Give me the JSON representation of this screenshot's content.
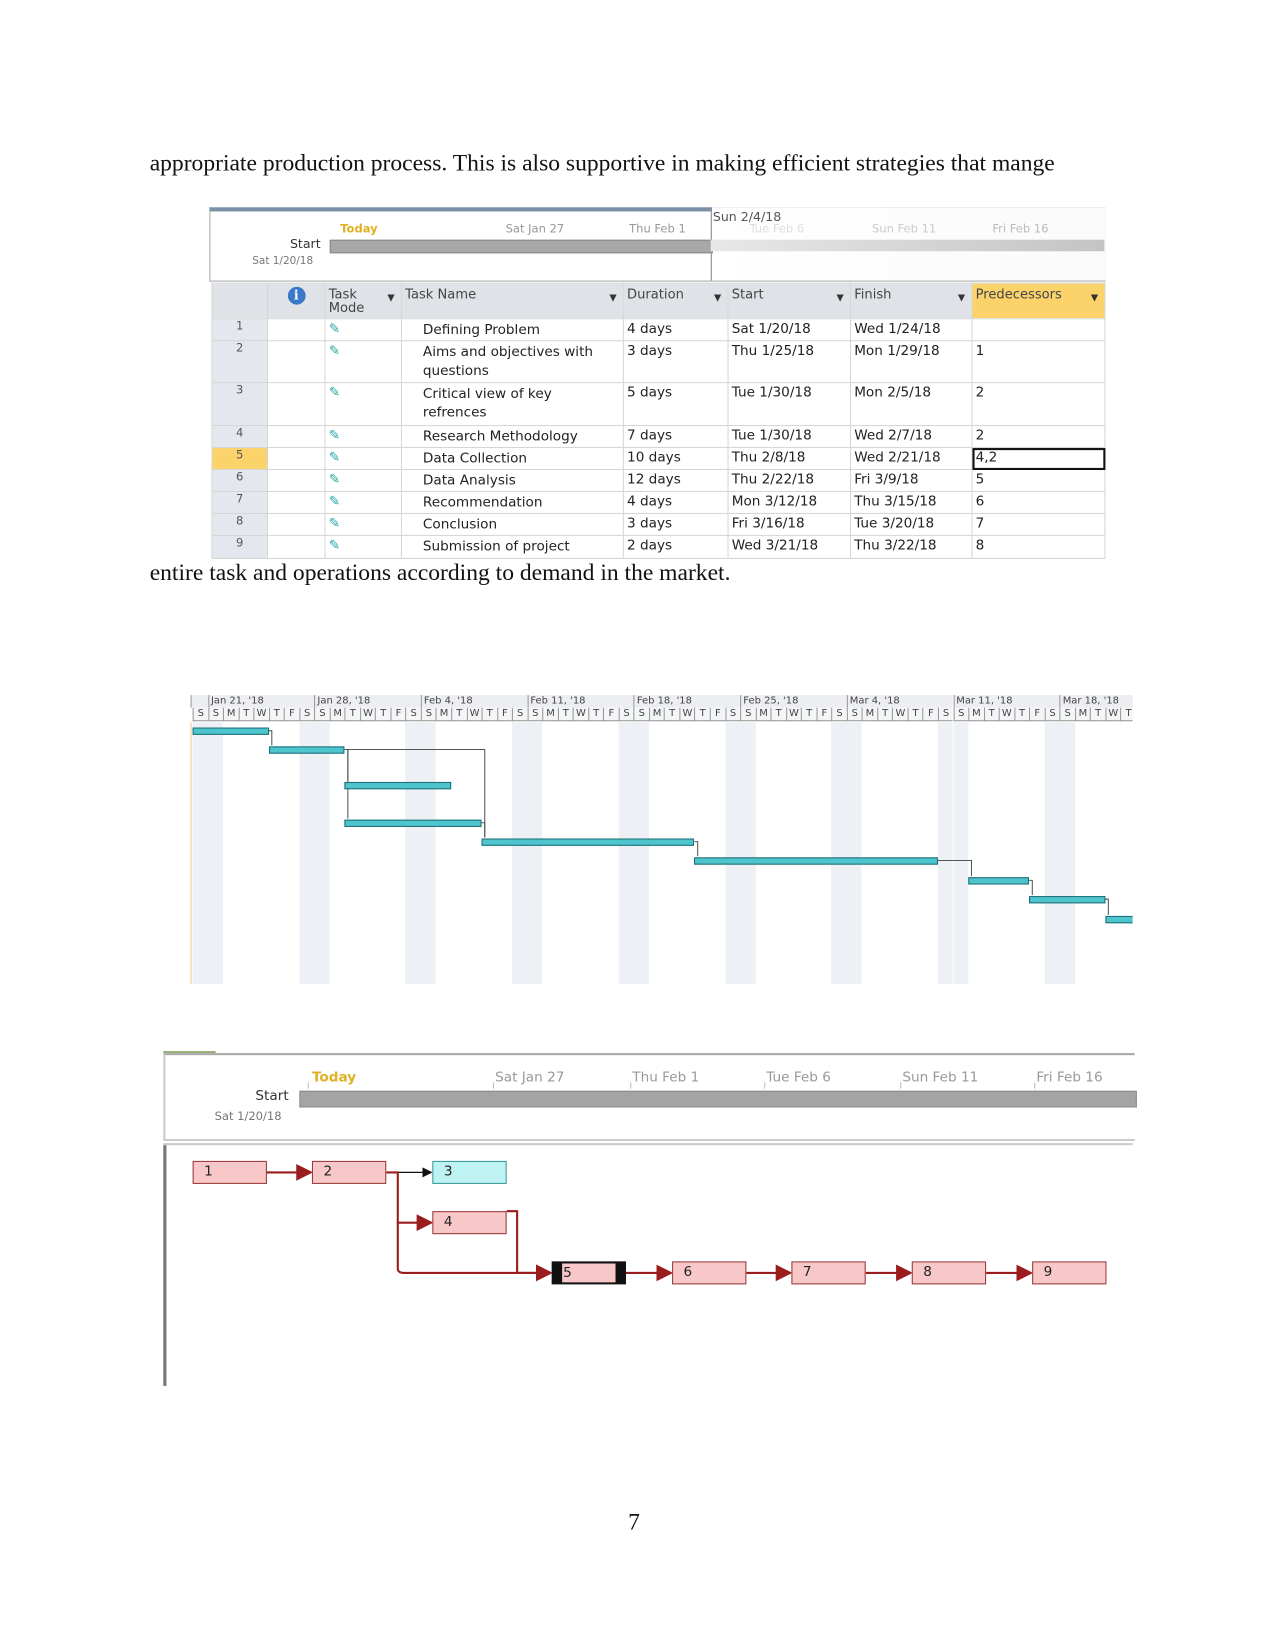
{
  "document": {
    "text_before": "appropriate production process. This is also supportive in making efficient strategies that mange",
    "text_after": "entire task and operations according to demand in the market.",
    "page_number": "7"
  },
  "timeline": {
    "today": "Today",
    "start_label": "Start",
    "start_date": "Sat 1/20/18",
    "current_marker": "Sun 2/4/18",
    "ticks": [
      "Sat Jan 27",
      "Thu Feb 1",
      "Tue Feb 6",
      "Sun Feb 11",
      "Fri Feb 16"
    ]
  },
  "table": {
    "headers": {
      "info": "i",
      "task_mode": "Task Mode",
      "task_name": "Task Name",
      "duration": "Duration",
      "start": "Start",
      "finish": "Finish",
      "predecessors": "Predecessors"
    },
    "rows": [
      {
        "id": "1",
        "name": "Defining Problem",
        "duration": "4 days",
        "start": "Sat 1/20/18",
        "finish": "Wed 1/24/18",
        "pred": ""
      },
      {
        "id": "2",
        "name": "Aims and objectives with questions",
        "duration": "3 days",
        "start": "Thu 1/25/18",
        "finish": "Mon 1/29/18",
        "pred": "1"
      },
      {
        "id": "3",
        "name": "Critical view of key refrences",
        "duration": "5 days",
        "start": "Tue 1/30/18",
        "finish": "Mon 2/5/18",
        "pred": "2"
      },
      {
        "id": "4",
        "name": "Research Methodology",
        "duration": "7 days",
        "start": "Tue 1/30/18",
        "finish": "Wed 2/7/18",
        "pred": "2"
      },
      {
        "id": "5",
        "name": "Data Collection",
        "duration": "10 days",
        "start": "Thu 2/8/18",
        "finish": "Wed 2/21/18",
        "pred": "4,2"
      },
      {
        "id": "6",
        "name": "Data Analysis",
        "duration": "12 days",
        "start": "Thu 2/22/18",
        "finish": "Fri 3/9/18",
        "pred": "5"
      },
      {
        "id": "7",
        "name": "Recommendation",
        "duration": "4 days",
        "start": "Mon 3/12/18",
        "finish": "Thu 3/15/18",
        "pred": "6"
      },
      {
        "id": "8",
        "name": "Conclusion",
        "duration": "3 days",
        "start": "Fri 3/16/18",
        "finish": "Tue 3/20/18",
        "pred": "7"
      },
      {
        "id": "9",
        "name": "Submission of project",
        "duration": "2 days",
        "start": "Wed 3/21/18",
        "finish": "Thu 3/22/18",
        "pred": "8"
      }
    ],
    "selected_row": "5"
  },
  "gantt": {
    "weeks": [
      "Jan 21, '18",
      "Jan 28, '18",
      "Feb 4, '18",
      "Feb 11, '18",
      "Feb 18, '18",
      "Feb 25, '18",
      "Mar 4, '18",
      "Mar 11, '18",
      "Mar 18, '18"
    ],
    "day_letters": [
      "S",
      "M",
      "T",
      "W",
      "T",
      "F",
      "S"
    ],
    "first_day": "S",
    "bar_color": "#4ec4cc"
  },
  "network": {
    "nodes": [
      "1",
      "2",
      "3",
      "4",
      "5",
      "6",
      "7",
      "8",
      "9"
    ],
    "critical_color": "#f8c8c8",
    "noncritical_color": "#bff3f3",
    "link_color": "#9b1c1c"
  }
}
